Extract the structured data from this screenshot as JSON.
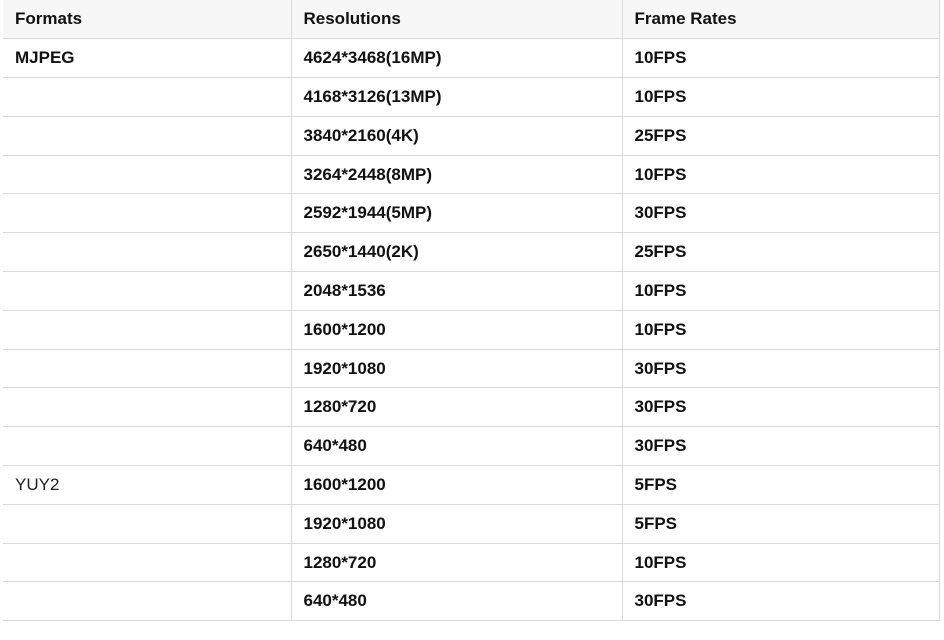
{
  "table": {
    "headers": [
      "Formats",
      "Resolutions",
      "Frame Rates"
    ],
    "rows": [
      {
        "format": "MJPEG",
        "resolution": "4624*3468(16MP)",
        "fps": "10FPS"
      },
      {
        "format": "",
        "resolution": "4168*3126(13MP)",
        "fps": "10FPS"
      },
      {
        "format": "",
        "resolution": "3840*2160(4K)",
        "fps": "25FPS"
      },
      {
        "format": "",
        "resolution": "3264*2448(8MP)",
        "fps": "10FPS"
      },
      {
        "format": "",
        "resolution": "2592*1944(5MP)",
        "fps": "30FPS"
      },
      {
        "format": "",
        "resolution": "2650*1440(2K)",
        "fps": "25FPS"
      },
      {
        "format": "",
        "resolution": "2048*1536",
        "fps": "10FPS"
      },
      {
        "format": "",
        "resolution": "1600*1200",
        "fps": "10FPS"
      },
      {
        "format": "",
        "resolution": "1920*1080",
        "fps": "30FPS"
      },
      {
        "format": "",
        "resolution": "1280*720",
        "fps": "30FPS"
      },
      {
        "format": "",
        "resolution": "640*480",
        "fps": "30FPS"
      },
      {
        "format": "YUY2",
        "resolution": "1600*1200",
        "fps": "5FPS"
      },
      {
        "format": "",
        "resolution": "1920*1080",
        "fps": "5FPS"
      },
      {
        "format": "",
        "resolution": "1280*720",
        "fps": "10FPS"
      },
      {
        "format": "",
        "resolution": "640*480",
        "fps": "30FPS"
      }
    ]
  }
}
